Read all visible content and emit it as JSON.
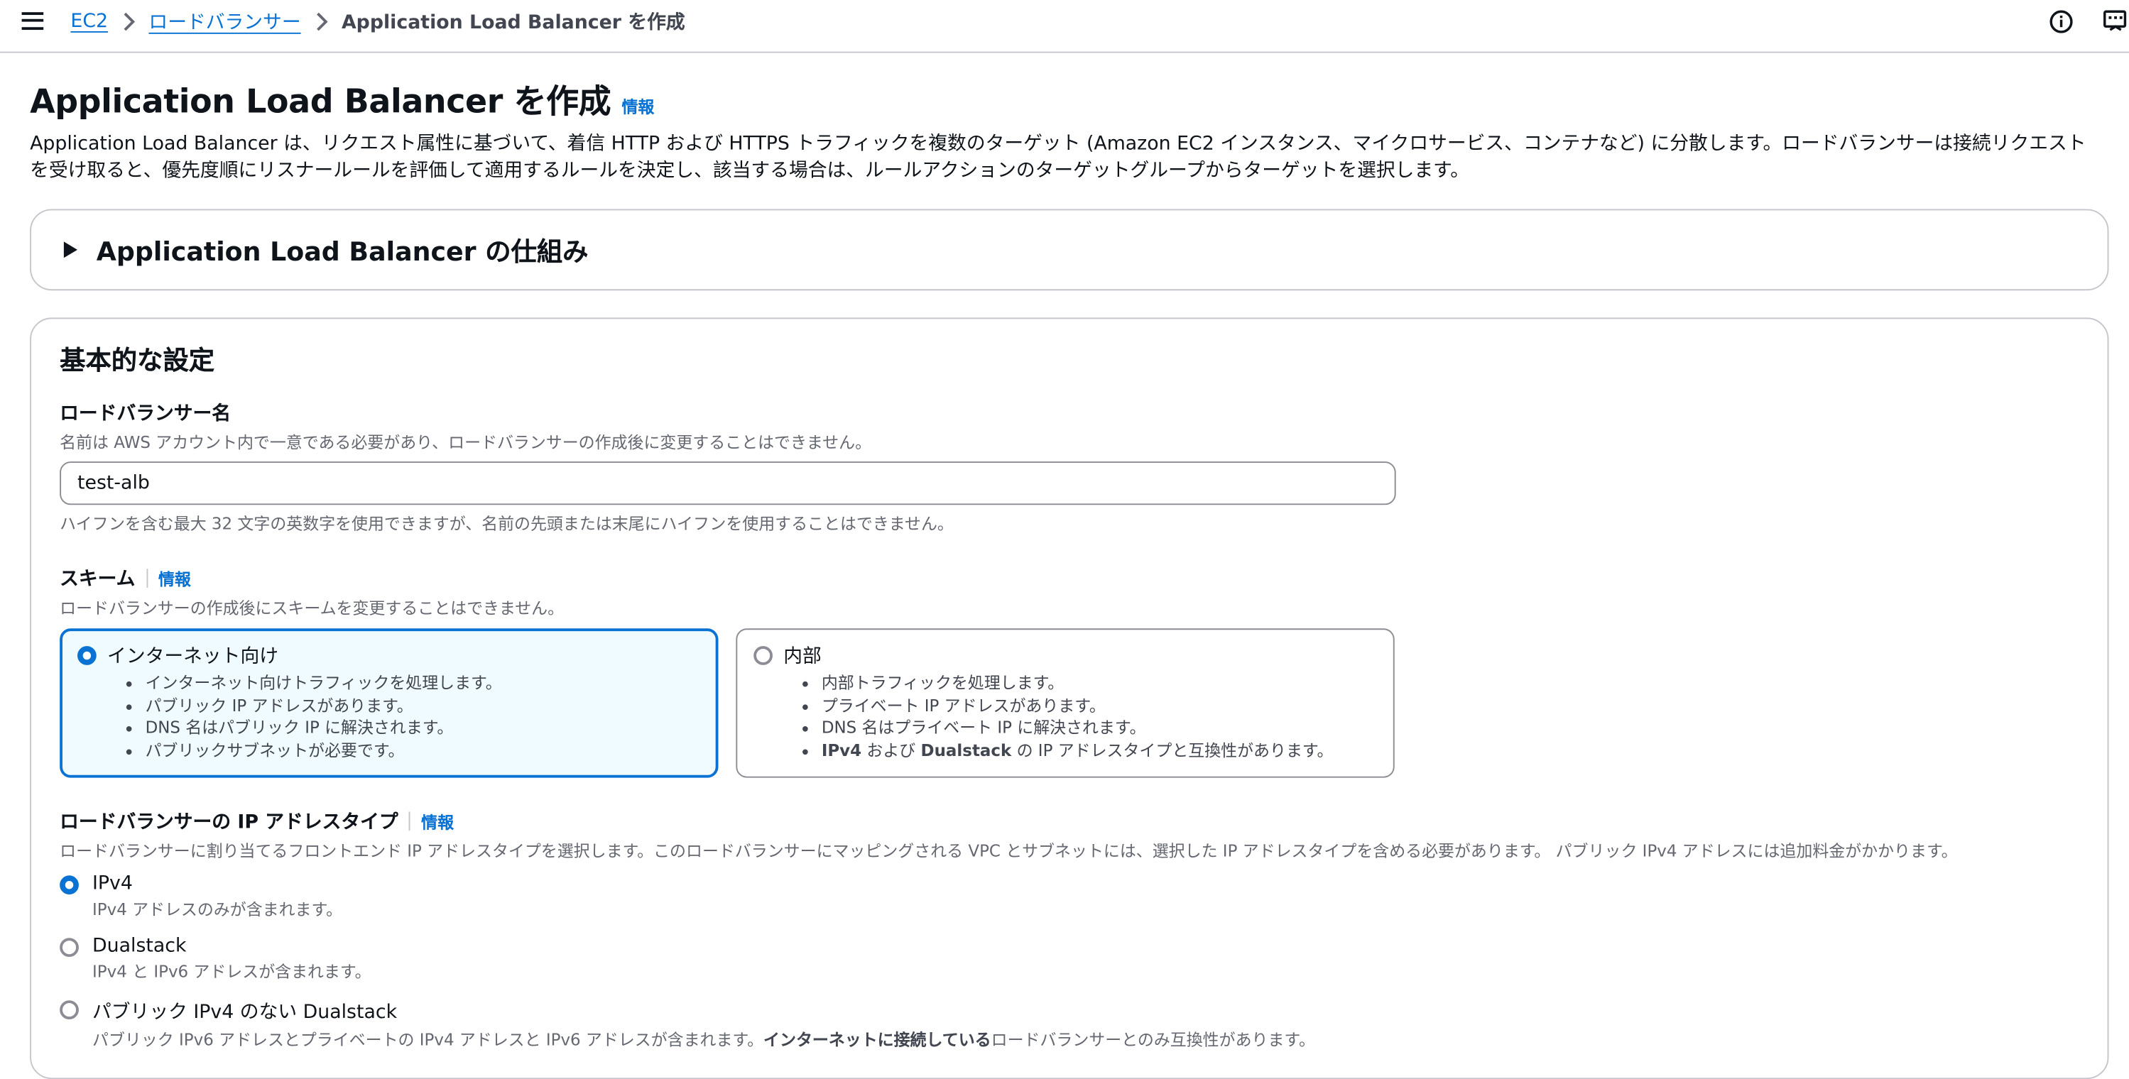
{
  "breadcrumb": {
    "items": [
      "EC2",
      "ロードバランサー"
    ],
    "current": "Application Load Balancer を作成"
  },
  "page": {
    "title": "Application Load Balancer を作成",
    "info": "情報",
    "description": "Application Load Balancer は、リクエスト属性に基づいて、着信 HTTP および HTTPS トラフィックを複数のターゲット (Amazon EC2 インスタンス、マイクロサービス、コンテナなど) に分散します。ロードバランサーは接続リクエストを受け取ると、優先度順にリスナールールを評価して適用するルールを決定し、該当する場合は、ルールアクションのターゲットグループからターゲットを選択します。"
  },
  "how_it_works": {
    "title": "Application Load Balancer の仕組み"
  },
  "basic": {
    "title": "基本的な設定",
    "name": {
      "label": "ロードバランサー名",
      "description": "名前は AWS アカウント内で一意である必要があり、ロードバランサーの作成後に変更することはできません。",
      "value": "test-alb",
      "constraint": "ハイフンを含む最大 32 文字の英数字を使用できますが、名前の先頭または末尾にハイフンを使用することはできません。"
    },
    "scheme": {
      "label": "スキーム",
      "info": "情報",
      "description": "ロードバランサーの作成後にスキームを変更することはできません。",
      "internet": {
        "label": "インターネット向け",
        "bullets": [
          "インターネット向けトラフィックを処理します。",
          "パブリック IP アドレスがあります。",
          "DNS 名はパブリック IP に解決されます。",
          "パブリックサブネットが必要です。"
        ]
      },
      "internal": {
        "label": "内部",
        "bullets": [
          "内部トラフィックを処理します。",
          "プライベート IP アドレスがあります。",
          "DNS 名はプライベート IP に解決されます。"
        ],
        "last_parts": [
          "IPv4",
          " および ",
          "Dualstack",
          " の IP アドレスタイプと互換性があります。"
        ]
      }
    },
    "ip_type": {
      "label": "ロードバランサーの IP アドレスタイプ",
      "info": "情報",
      "description": "ロードバランサーに割り当てるフロントエンド IP アドレスタイプを選択します。このロードバランサーにマッピングされる VPC とサブネットには、選択した IP アドレスタイプを含める必要があります。 パブリック IPv4 アドレスには追加料金がかかります。",
      "options": [
        {
          "label": "IPv4",
          "desc": "IPv4 アドレスのみが含まれます。"
        },
        {
          "label": "Dualstack",
          "desc": "IPv4 と IPv6 アドレスが含まれます。"
        },
        {
          "label": "パブリック IPv4 のない Dualstack",
          "desc_parts": [
            "パブリック IPv6 アドレスとプライベートの IPv4 アドレスと IPv6 アドレスが含まれます。",
            "インターネットに接続している",
            "ロードバランサーとのみ互換性があります。"
          ]
        }
      ]
    }
  },
  "colors": {
    "accent": "#0972d3",
    "selected_bg": "#f0fbff"
  }
}
